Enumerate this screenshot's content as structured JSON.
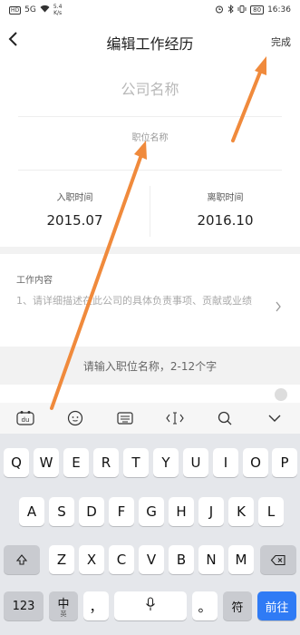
{
  "status_bar": {
    "hd": "HD",
    "signal": "5G",
    "speed_top": "5.4",
    "speed_bottom": "K/s",
    "battery": "80",
    "time": "16:36"
  },
  "nav": {
    "back_icon": "back-chevron-icon",
    "title": "编辑工作经历",
    "done_label": "完成"
  },
  "form": {
    "company_placeholder": "公司名称",
    "position_placeholder": "职位名称",
    "start_label": "入职时间",
    "start_value": "2015.07",
    "end_label": "离职时间",
    "end_value": "2016.10",
    "work_label": "工作内容",
    "work_placeholder": "1、请详细描述在此公司的具体负责事项、贡献或业绩"
  },
  "hint": {
    "text": "请输入职位名称，2-12个字"
  },
  "keyboard": {
    "row1": [
      "Q",
      "W",
      "E",
      "R",
      "T",
      "Y",
      "U",
      "I",
      "O",
      "P"
    ],
    "row2": [
      "A",
      "S",
      "D",
      "F",
      "G",
      "H",
      "J",
      "K",
      "L"
    ],
    "row3": [
      "Z",
      "X",
      "C",
      "V",
      "B",
      "N",
      "M"
    ],
    "num_label": "123",
    "lang_label": "中",
    "lang_sub": "英",
    "comma": "，",
    "period": "。",
    "symbol_label": "符",
    "go_label": "前往"
  },
  "colors": {
    "accent": "#2f7bf5",
    "annotation": "#f08a3c"
  }
}
